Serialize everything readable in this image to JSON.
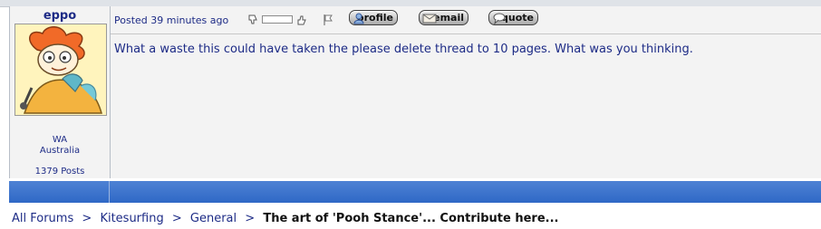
{
  "post": {
    "username": "eppo",
    "location_line1": "WA",
    "location_line2": "Australia",
    "post_count": "1379 Posts",
    "posted_text": "Posted 39 minutes ago",
    "buttons": {
      "profile": "profile",
      "email": "email",
      "quote": "quote"
    },
    "message": "What a waste this could have taken the please delete thread to 10 pages. What was you thinking."
  },
  "breadcrumb": {
    "items": [
      "All Forums",
      "Kitesurfing",
      "General"
    ],
    "separator": ">",
    "current": "The art of 'Pooh Stance'... Contribute here..."
  },
  "colors": {
    "accent_bar": "#2f68c6",
    "text": "#1d2b86",
    "panel": "#f3f3f3"
  }
}
